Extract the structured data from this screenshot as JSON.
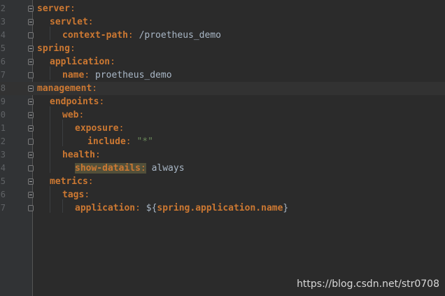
{
  "gutter": {
    "line_numbers": [
      "2",
      "3",
      "4",
      "5",
      "6",
      "7",
      "8",
      "9",
      "0",
      "1",
      "2",
      "3",
      "4",
      "5",
      "6",
      "7"
    ]
  },
  "code": {
    "lines": [
      {
        "key": "server",
        "colon": ":",
        "value": ""
      },
      {
        "key": "servlet",
        "colon": ":",
        "value": ""
      },
      {
        "key": "context-path",
        "colon": ":",
        "value": "/proetheus_demo"
      },
      {
        "key": "spring",
        "colon": ":",
        "value": ""
      },
      {
        "key": "application",
        "colon": ":",
        "value": ""
      },
      {
        "key": "name",
        "colon": ":",
        "value": "proetheus_demo"
      },
      {
        "key": "management",
        "colon": ":",
        "value": ""
      },
      {
        "key": "endpoints",
        "colon": ":",
        "value": ""
      },
      {
        "key": "web",
        "colon": ":",
        "value": ""
      },
      {
        "key": "exposure",
        "colon": ":",
        "value": ""
      },
      {
        "key": "include",
        "colon": ":",
        "value": "\"*\""
      },
      {
        "key": "health",
        "colon": ":",
        "value": ""
      },
      {
        "key": "show-datails",
        "colon": ":",
        "value": "always"
      },
      {
        "key": "metrics",
        "colon": ":",
        "value": ""
      },
      {
        "key": "tags",
        "colon": ":",
        "value": ""
      },
      {
        "key": "application",
        "colon": ":",
        "value_prefix": "${",
        "value_inner": "spring.application.name",
        "value_suffix": "}"
      }
    ]
  },
  "watermark": "https://blog.csdn.net/str0708",
  "colors": {
    "background": "#2b2b2b",
    "key": "#cc7832",
    "value": "#a9b7c6",
    "string": "#6a8759",
    "highlight": "#52503a"
  }
}
